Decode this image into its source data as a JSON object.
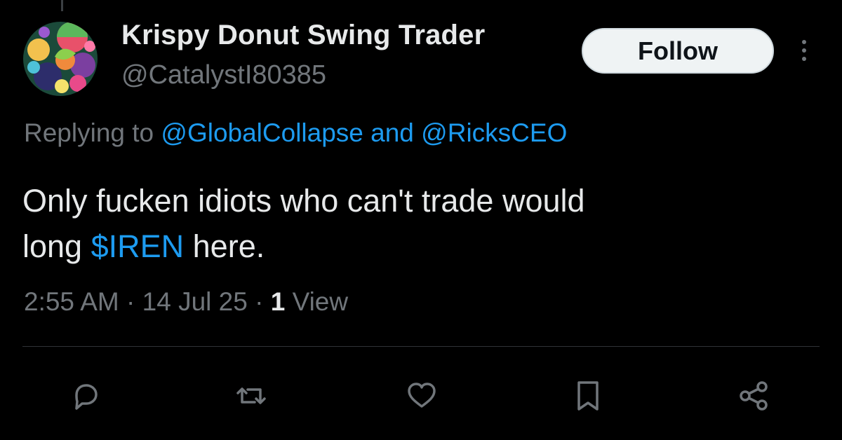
{
  "tweet": {
    "author": {
      "display_name": "Krispy Donut Swing Trader",
      "handle": "@CatalystI80385"
    },
    "follow_label": "Follow",
    "reply": {
      "prefix": "Replying to",
      "mention_1": "@GlobalCollapse",
      "joiner": "and",
      "mention_2": "@RicksCEO"
    },
    "text": {
      "line_1": "Only fucken idiots who can't trade would",
      "line_2_start": "long",
      "cashtag": "$IREN",
      "line_2_end": "here."
    },
    "meta": {
      "time": "2:55 AM",
      "sep_1": "·",
      "date": "14 Jul 25",
      "sep_2": "·",
      "view_count": "1",
      "view_label": "View"
    },
    "actions": [
      {
        "icon": "reply-icon"
      },
      {
        "icon": "retweet-icon"
      },
      {
        "icon": "like-icon"
      },
      {
        "icon": "bookmark-icon"
      },
      {
        "icon": "share-icon"
      }
    ]
  },
  "colors": {
    "background": "#000000",
    "text_primary": "#e7e9ea",
    "text_secondary": "#71767b",
    "link": "#1d9bf0",
    "divider": "#2f3336",
    "follow_bg": "#eff3f4"
  }
}
